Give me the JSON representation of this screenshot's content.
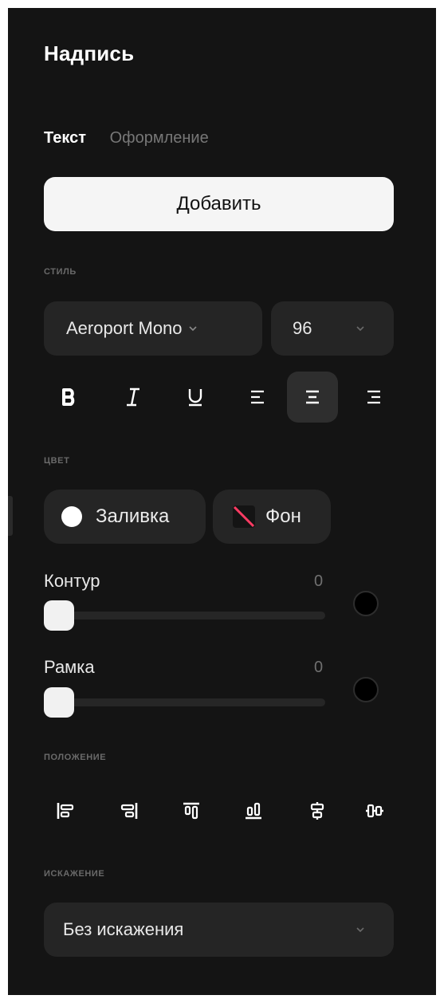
{
  "panel": {
    "title": "Надпись"
  },
  "tabs": [
    {
      "label": "Текст",
      "active": true
    },
    {
      "label": "Оформление",
      "active": false
    }
  ],
  "add_button": {
    "label": "Добавить"
  },
  "style_section": {
    "label": "стиль",
    "font_family": "Aeroport Mono",
    "font_size": "96",
    "format_buttons": [
      {
        "name": "bold",
        "icon": "bold-icon",
        "active": false
      },
      {
        "name": "italic",
        "icon": "italic-icon",
        "active": false
      },
      {
        "name": "underline",
        "icon": "underline-icon",
        "active": false
      },
      {
        "name": "align-left",
        "icon": "align-left-icon",
        "active": false
      },
      {
        "name": "align-center",
        "icon": "align-center-icon",
        "active": true
      },
      {
        "name": "align-right",
        "icon": "align-right-icon",
        "active": false
      }
    ]
  },
  "color_section": {
    "label": "цвет",
    "fill": {
      "label": "Заливка",
      "color": "#ffffff"
    },
    "background": {
      "label": "Фон",
      "color": "none"
    }
  },
  "outline": {
    "label": "Контур",
    "value": "0",
    "value_fraction": 0,
    "color": "#000000"
  },
  "frame": {
    "label": "Рамка",
    "value": "0",
    "value_fraction": 0,
    "color": "#000000"
  },
  "position_section": {
    "label": "положение",
    "buttons": [
      {
        "icon": "align-left-edge-icon"
      },
      {
        "icon": "align-right-edge-icon"
      },
      {
        "icon": "align-top-edge-icon"
      },
      {
        "icon": "align-bottom-edge-icon"
      },
      {
        "icon": "align-horizontal-center-icon"
      },
      {
        "icon": "align-vertical-center-icon"
      }
    ]
  },
  "distortion_section": {
    "label": "искажение",
    "selected": "Без искажения"
  },
  "colors": {
    "panel_bg": "#141414",
    "control_bg": "#252525",
    "accent_button_bg": "#f5f5f5",
    "muted_text": "#6a6a6a"
  }
}
